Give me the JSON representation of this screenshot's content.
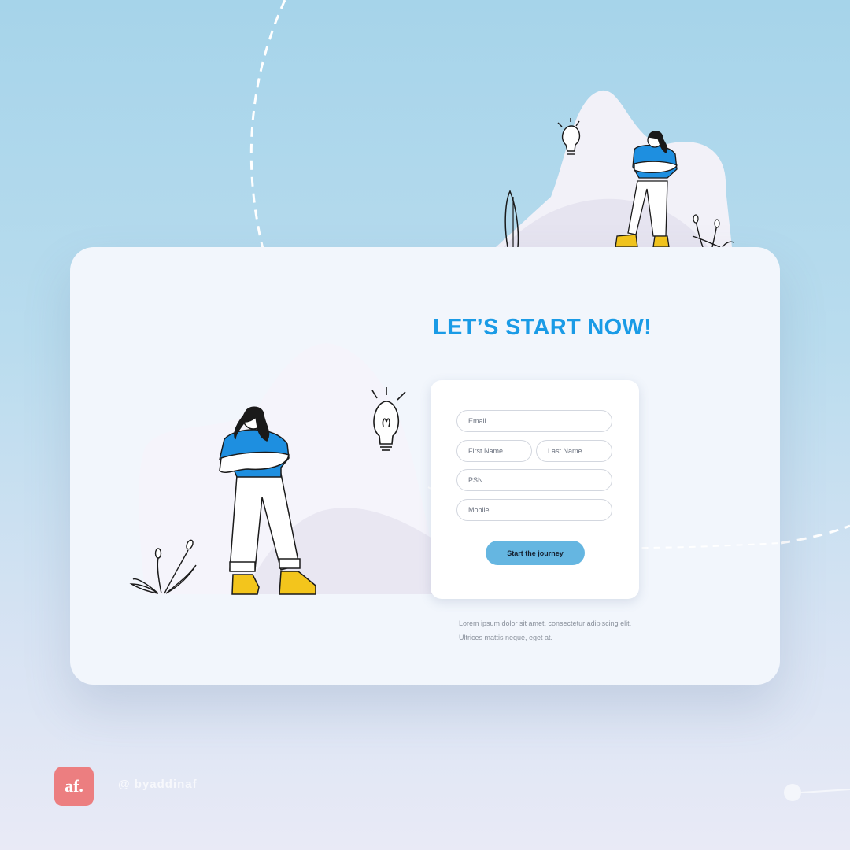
{
  "hero": {
    "title": "LET’S START NOW!"
  },
  "form": {
    "email_placeholder": "Email",
    "first_name_placeholder": "First Name",
    "last_name_placeholder": "Last Name",
    "psn_placeholder": "PSN",
    "mobile_placeholder": "Mobile",
    "submit_label": "Start the journey"
  },
  "description": "Lorem ipsum dolor sit amet, consectetur adipiscing elit. Ultrices mattis neque, eget at.",
  "footer": {
    "logo_text": "af.",
    "handle": "@ byaddinaf"
  },
  "colors": {
    "accent": "#1a9be6",
    "button": "#65b6e1",
    "logo": "#ec7e80",
    "shirt": "#1e8fe0",
    "boots": "#f3c51c"
  },
  "icons": [
    "lightbulb-icon",
    "plant-icon",
    "character-illustration"
  ]
}
